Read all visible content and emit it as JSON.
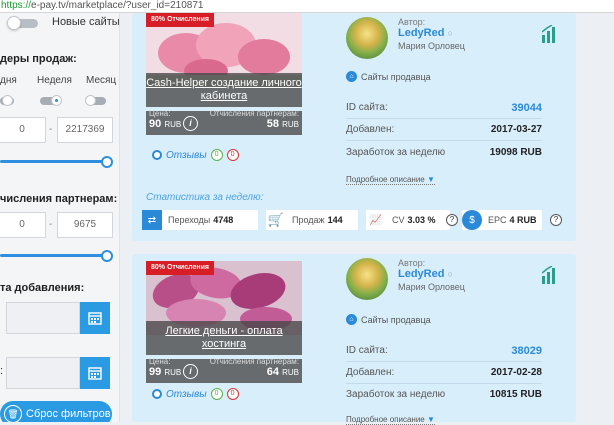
{
  "url": {
    "scheme": "https://",
    "rest": "e-pay.tv/marketplace/?user_id=210871"
  },
  "sidebar": {
    "new_sites_label": "Новые сайты",
    "sales_leaders_heading": "деры продаж:",
    "periods": [
      "дня",
      "Неделя",
      "Месяц"
    ],
    "sales_min": "0",
    "sales_max": "2217369",
    "partner_heading": "числения партнерам:",
    "partner_min": "0",
    "partner_max": "9675",
    "date_heading": "та добавления:",
    "date_sep": ":",
    "reset_label": "Сброс фильтров"
  },
  "cards": [
    {
      "ribbon": "80% Отчисления",
      "title": "Cash-Helper создание личного кабинета",
      "price_label": "Цена:",
      "partner_label": "Отчисления партнёрам:",
      "price": "90",
      "price_cur": "RUB",
      "partner_value": "58",
      "partner_cur": "RUB",
      "reviews_label": "Отзывы",
      "reviews_pos": "0",
      "reviews_neg": "0",
      "author_label": "Автор:",
      "author_name": "LedyRed",
      "author_real": "Мария Орловец",
      "seller_sites": "Сайты продавца",
      "site_id_label": "ID сайта:",
      "site_id": "39044",
      "added_label": "Добавлен:",
      "added": "2017-03-27",
      "earn_label": "Заработок за неделю",
      "earn": "19098 RUB",
      "more_label": "Подробное описание",
      "week_stats": "Статистика за неделю:",
      "transitions_label": "Переходы",
      "transitions": "4748",
      "sales_label": "Продаж",
      "sales": "144",
      "cv_label": "CV",
      "cv": "3.03 %",
      "epc_label": "EPC",
      "epc": "4 RUB"
    },
    {
      "ribbon": "80% Отчисления",
      "title": "Легкие деньги - оплата хостинга",
      "price_label": "Цена:",
      "partner_label": "Отчисления партнёрам:",
      "price": "99",
      "price_cur": "RUB",
      "partner_value": "64",
      "partner_cur": "RUB",
      "reviews_label": "Отзывы",
      "reviews_pos": "0",
      "reviews_neg": "0",
      "author_label": "Автор:",
      "author_name": "LedyRed",
      "author_real": "Мария Орловец",
      "seller_sites": "Сайты продавца",
      "site_id_label": "ID сайта:",
      "site_id": "38029",
      "added_label": "Добавлен:",
      "added": "2017-02-28",
      "earn_label": "Заработок за неделю",
      "earn": "10815 RUB",
      "more_label": "Подробное описание"
    }
  ],
  "colors": {
    "accent": "#2a9be2",
    "card_bg": "#d9eefb",
    "ribbon": "#d71e26"
  }
}
